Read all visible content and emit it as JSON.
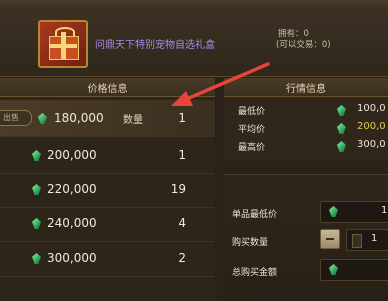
{
  "window": {
    "title": ""
  },
  "item": {
    "name": "问鼎天下特别宠物自选礼盒",
    "owned": "拥有：0",
    "tradable": "(可以交易：0)",
    "icon": "gift-box-icon"
  },
  "price_panel": {
    "title": "价格信息",
    "tab_label": "出售",
    "qty_header": "数量",
    "currency_icon": "green-gem-icon",
    "rows": [
      {
        "price": "180,000",
        "qty": "1"
      },
      {
        "price": "200,000",
        "qty": "1"
      },
      {
        "price": "220,000",
        "qty": "19"
      },
      {
        "price": "240,000",
        "qty": "4"
      },
      {
        "price": "300,000",
        "qty": "2"
      }
    ]
  },
  "market_panel": {
    "title": "行情信息",
    "rows": [
      {
        "label": "最低价",
        "value": "100,0"
      },
      {
        "label": "平均价",
        "value": "200,0"
      },
      {
        "label": "最高价",
        "value": "300,0"
      }
    ]
  },
  "order_panel": {
    "unit_min_label": "单品最低价",
    "unit_min_value": "1",
    "buy_qty_label": "购买数量",
    "buy_qty_value": "1",
    "total_label": "总购买金额"
  },
  "colors": {
    "item_name": "#a98ae8",
    "avg_price": "#e8c84a",
    "annotation_arrow": "#e8443a"
  }
}
